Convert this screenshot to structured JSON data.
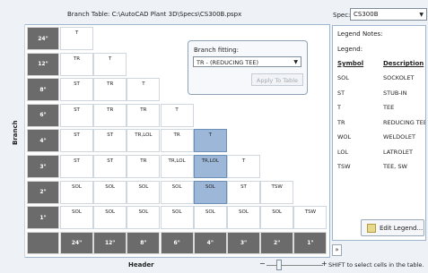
{
  "title": "Branch Table: C:\\AutoCAD Plant 3D\\Specs\\CS300B.pspx",
  "spec": {
    "label": "Spec:",
    "value": "CS300B"
  },
  "axis": {
    "branch": "Branch",
    "header": "Header"
  },
  "rows": [
    "24\"",
    "12\"",
    "8\"",
    "6\"",
    "4\"",
    "3\"",
    "2\"",
    "1\""
  ],
  "cols": [
    "24\"",
    "12\"",
    "8\"",
    "6\"",
    "4\"",
    "3\"",
    "2\"",
    "1\""
  ],
  "cells": [
    [
      "T"
    ],
    [
      "TR",
      "T"
    ],
    [
      "ST",
      "TR",
      "T"
    ],
    [
      "ST",
      "TR",
      "TR",
      "T"
    ],
    [
      "ST",
      "ST",
      "TR,LOL",
      "TR",
      "T"
    ],
    [
      "ST",
      "ST",
      "TR",
      "TR,LOL",
      "TR,LOL",
      "T"
    ],
    [
      "SOL",
      "SOL",
      "SOL",
      "SOL",
      "SOL",
      "ST",
      "TSW"
    ],
    [
      "SOL",
      "SOL",
      "SOL",
      "SOL",
      "SOL",
      "SOL",
      "SOL",
      "TSW"
    ]
  ],
  "fitting": {
    "label": "Branch fitting:",
    "value": "TR - (REDUCING TEE)",
    "apply_label": "Apply To Table"
  },
  "legend": {
    "notes": "Legend Notes:",
    "legend_label": "Legend:",
    "symbol_header": "Symbol",
    "desc_header": "Description",
    "items": [
      {
        "s": "SOL",
        "d": "SOCKOLET"
      },
      {
        "s": "ST",
        "d": "STUB-IN"
      },
      {
        "s": "T",
        "d": "TEE"
      },
      {
        "s": "TR",
        "d": "REDUCING TEE"
      },
      {
        "s": "WOL",
        "d": "WELDOLET"
      },
      {
        "s": "LOL",
        "d": "LATROLET"
      },
      {
        "s": "TSW",
        "d": "TEE, SW"
      }
    ],
    "edit_label": "Edit Legend..."
  },
  "expand_label": "»",
  "zoom": {
    "minus": "−",
    "plus": "+"
  },
  "status": "SHIFT to select cells in the table."
}
